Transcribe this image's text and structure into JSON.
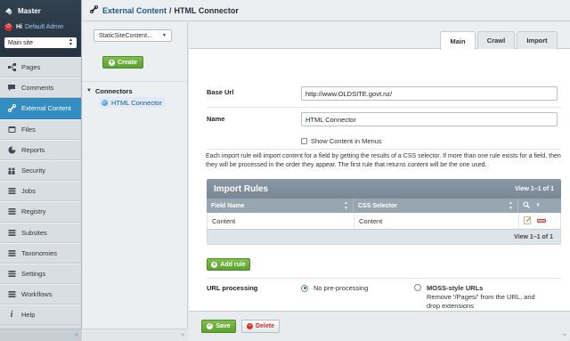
{
  "app": {
    "title": "Master",
    "greeting": "Hi",
    "user": "Default Admin",
    "site_select": "Main site"
  },
  "nav": {
    "items": [
      {
        "label": "Pages",
        "icon": "sitemap-icon"
      },
      {
        "label": "Comments",
        "icon": "comment-icon"
      },
      {
        "label": "External Content",
        "icon": "link-icon",
        "active": true
      },
      {
        "label": "Files",
        "icon": "files-icon"
      },
      {
        "label": "Reports",
        "icon": "chart-icon"
      },
      {
        "label": "Security",
        "icon": "users-icon"
      },
      {
        "label": "Jobs",
        "icon": "list-icon"
      },
      {
        "label": "Registry",
        "icon": "list-icon"
      },
      {
        "label": "Subsites",
        "icon": "list-icon"
      },
      {
        "label": "Taxonomies",
        "icon": "list-icon"
      },
      {
        "label": "Settings",
        "icon": "settings-icon"
      },
      {
        "label": "Workflows",
        "icon": "list-icon"
      },
      {
        "label": "Help",
        "icon": "help-icon"
      }
    ]
  },
  "header": {
    "crumb": "External Content",
    "separator": "/",
    "title": "HTML Connector"
  },
  "tree": {
    "type_select": "StaticSiteContent...",
    "create_label": "Create",
    "root_label": "Connectors",
    "leaf_label": "HTML Connector"
  },
  "tabs": [
    {
      "label": "Main",
      "active": true
    },
    {
      "label": "Crawl"
    },
    {
      "label": "Import"
    }
  ],
  "form": {
    "base_url_label": "Base Url",
    "base_url_value": "http://www.OLDSITE.govt.nz/",
    "name_label": "Name",
    "name_value": "HTML Connector",
    "show_in_menus_label": "Show Content in Menus",
    "help_text": "Each import rule will import content for a field by getting the results of a CSS selector. If more than one rule exists for a field, then they will be processed in the order they appear. The first rule that returns content will be the one used."
  },
  "import_rules": {
    "title": "Import Rules",
    "count_top": "View 1–1 of 1",
    "columns": [
      "Field Name",
      "CSS Selector"
    ],
    "rows": [
      {
        "field": "Content",
        "selector": "Content"
      }
    ],
    "count_bottom": "View 1–1 of 1",
    "add_label": "Add rule"
  },
  "url_processing": {
    "label": "URL processing",
    "option1": "No pre-processing",
    "option2_title": "MOSS-style URLs",
    "option2_desc1": "Remove '/Pages/' from the URL, and",
    "option2_desc2": "drop extensions"
  },
  "actions": {
    "save_label": "Save",
    "delete_label": "Delete"
  }
}
